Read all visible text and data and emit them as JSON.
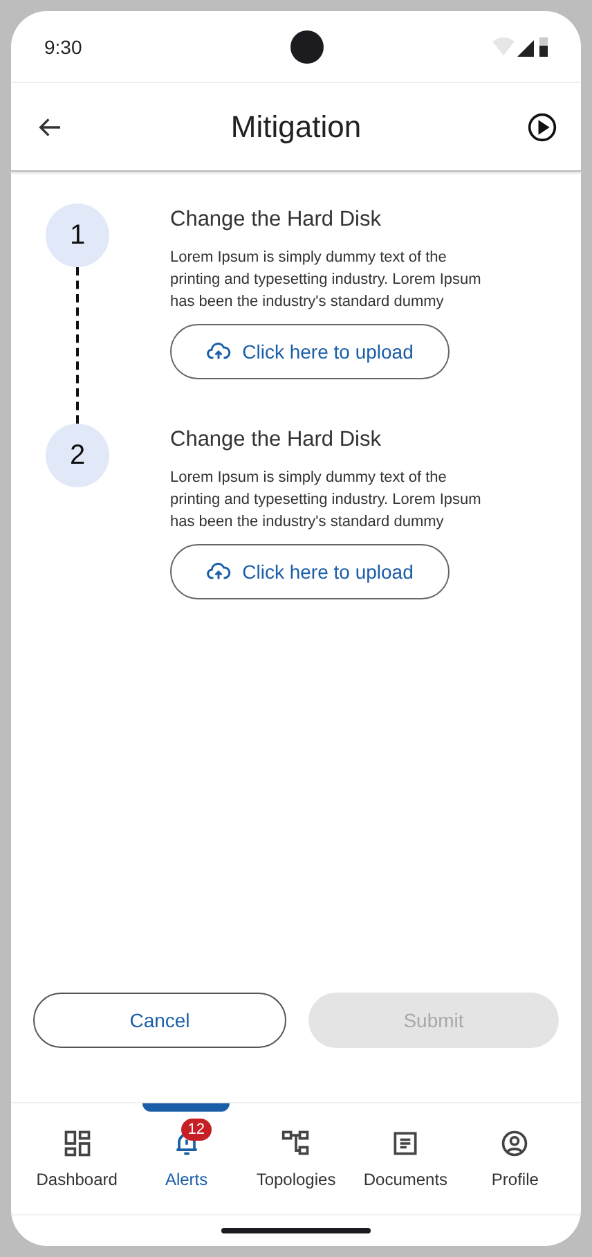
{
  "status_bar": {
    "time": "9:30"
  },
  "app_bar": {
    "title": "Mitigation"
  },
  "steps": [
    {
      "number": "1",
      "title": "Change the Hard Disk",
      "description": "Lorem Ipsum is simply dummy text of the printing and typesetting industry. Lorem Ipsum has been the industry's standard dummy",
      "upload_label": "Click here to upload"
    },
    {
      "number": "2",
      "title": "Change the Hard Disk",
      "description": "Lorem Ipsum is simply dummy text of the printing and typesetting industry. Lorem Ipsum has been the industry's standard dummy",
      "upload_label": "Click here to upload"
    }
  ],
  "actions": [
    {
      "label": "Cancel",
      "kind": "outline",
      "disabled": false
    },
    {
      "label": "Submit",
      "kind": "filled",
      "disabled": true
    }
  ],
  "nav": [
    {
      "label": "Dashboard",
      "selected": false
    },
    {
      "label": "Alerts",
      "selected": true,
      "badge": "12"
    },
    {
      "label": "Topologies",
      "selected": false
    },
    {
      "label": "Documents",
      "selected": false
    },
    {
      "label": "Profile",
      "selected": false
    }
  ]
}
